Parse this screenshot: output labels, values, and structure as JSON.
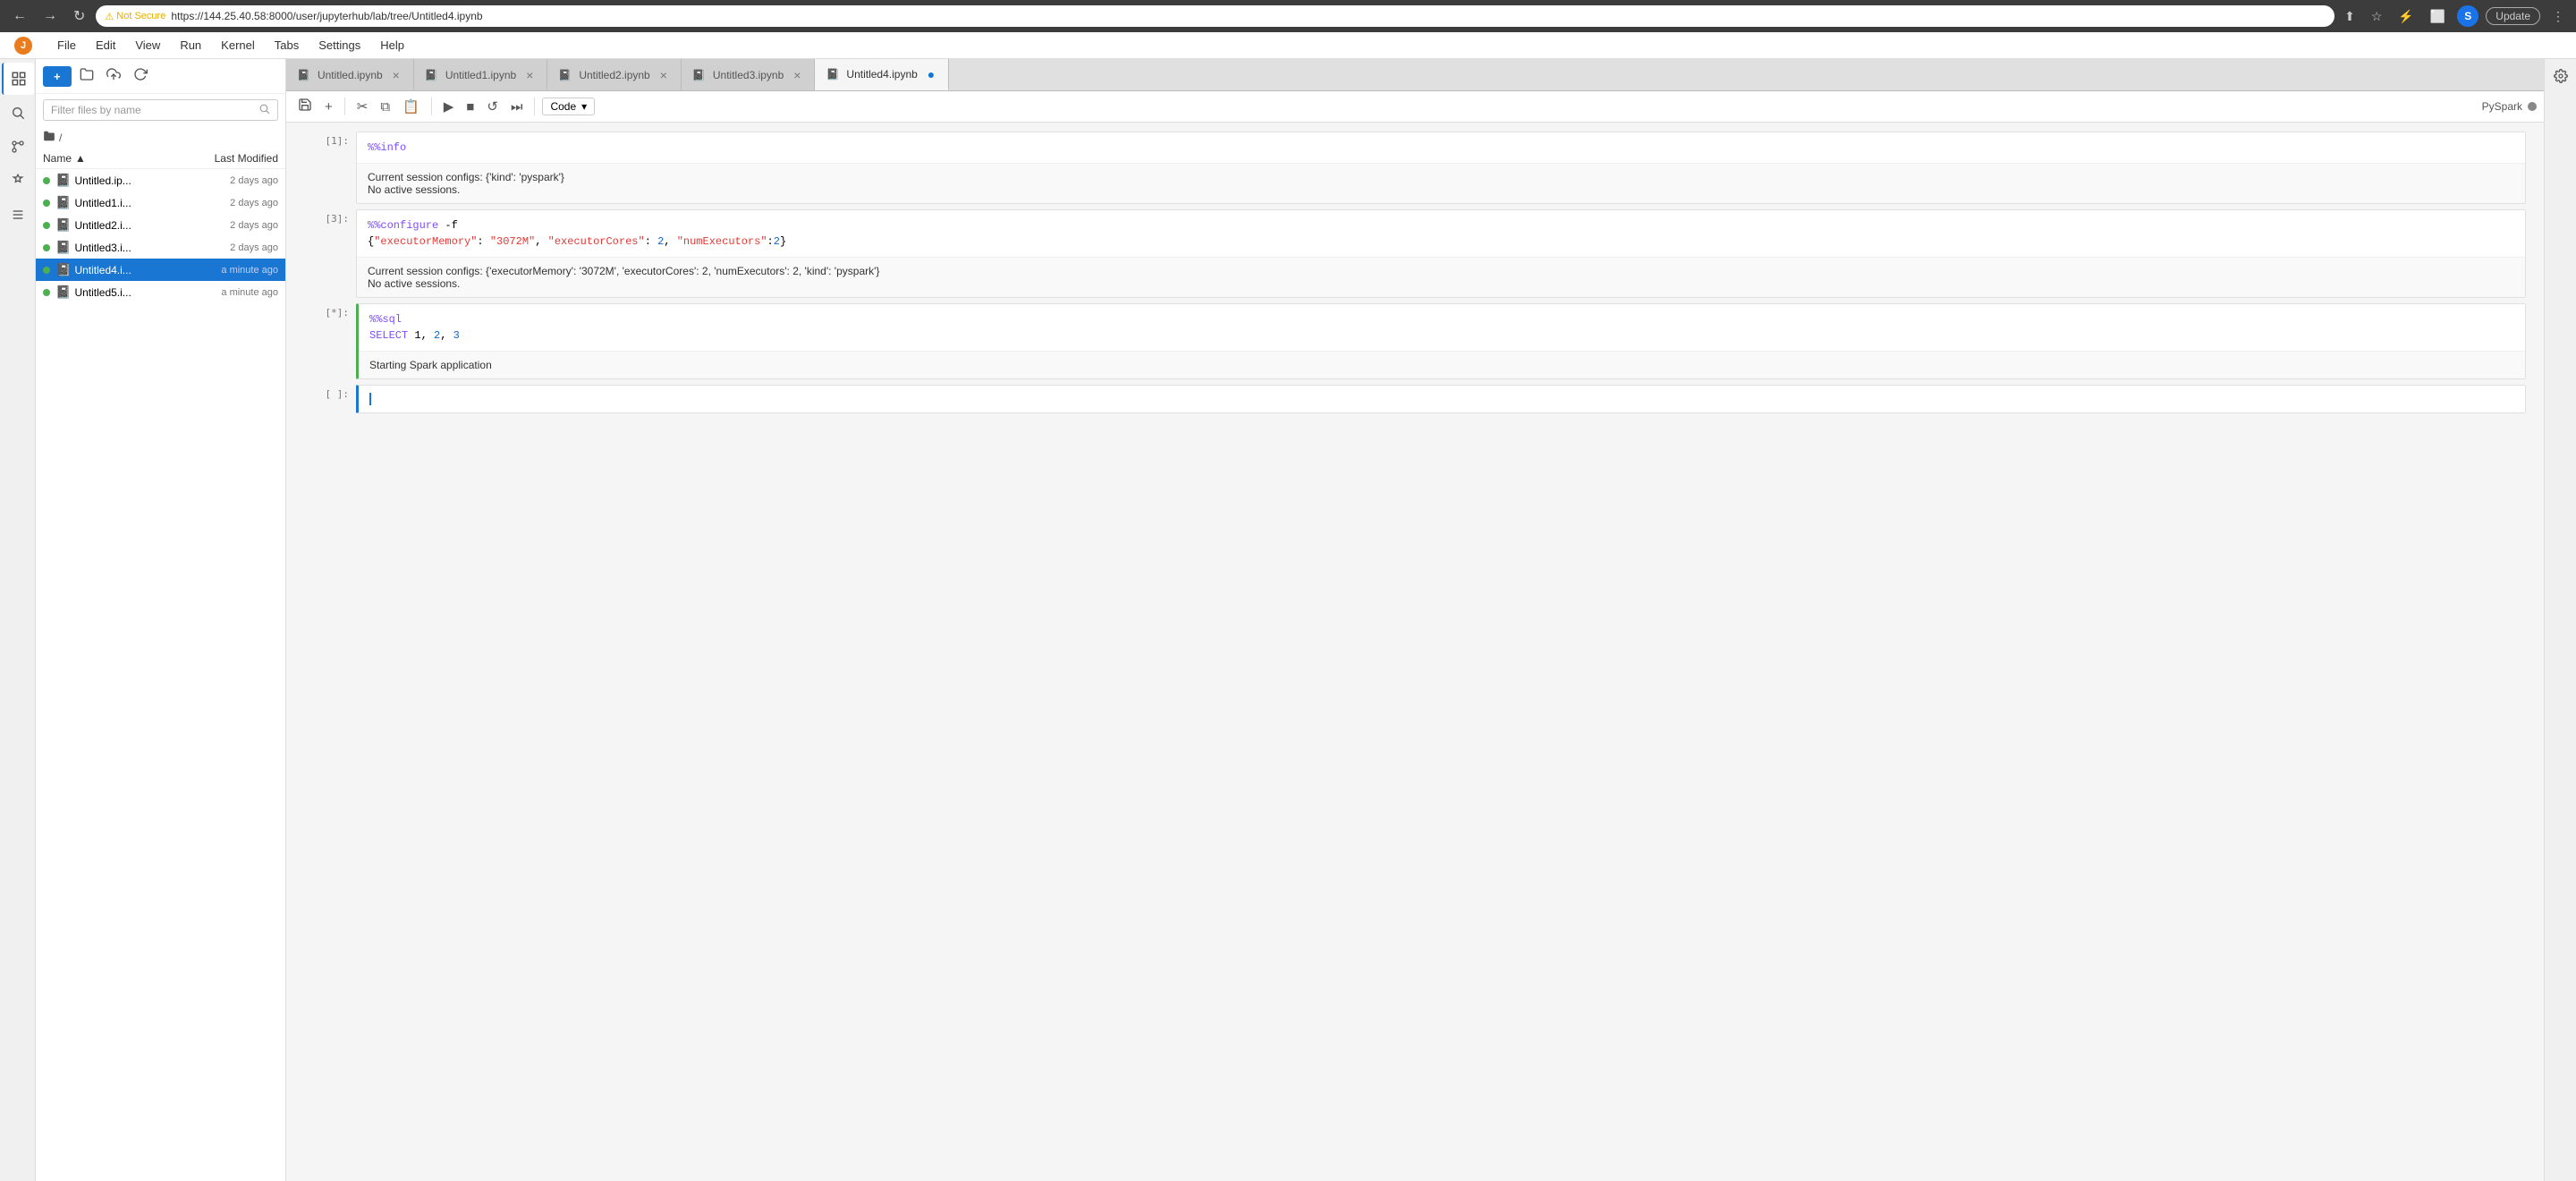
{
  "browser": {
    "back_label": "←",
    "forward_label": "→",
    "refresh_label": "↻",
    "security_warning": "Not Secure",
    "url": "https://144.25.40.58:8000/user/jupyterhub/lab/tree/Untitled4.ipynb",
    "url_short": "https://144.25.40.58:8000/user/jupyterhub/lab/tree/Untitled4.ipynb",
    "update_label": "Update",
    "avatar_letter": "S"
  },
  "menubar": {
    "items": [
      "File",
      "Edit",
      "View",
      "Run",
      "Kernel",
      "Tabs",
      "Settings",
      "Help"
    ]
  },
  "file_browser": {
    "new_button": "+",
    "filter_placeholder": "Filter files by name",
    "breadcrumb": "/",
    "columns": {
      "name": "Name",
      "modified": "Last Modified"
    },
    "files": [
      {
        "name": "Untitled.ip...",
        "modified": "2 days ago",
        "active": false
      },
      {
        "name": "Untitled1.i...",
        "modified": "2 days ago",
        "active": false
      },
      {
        "name": "Untitled2.i...",
        "modified": "2 days ago",
        "active": false
      },
      {
        "name": "Untitled3.i...",
        "modified": "2 days ago",
        "active": false
      },
      {
        "name": "Untitled4.i...",
        "modified": "a minute ago",
        "active": true
      },
      {
        "name": "Untitled5.i...",
        "modified": "a minute ago",
        "active": false
      }
    ]
  },
  "tabs": [
    {
      "label": "Untitled.ipynb",
      "active": false,
      "close": "×"
    },
    {
      "label": "Untitled1.ipynb",
      "active": false,
      "close": "×"
    },
    {
      "label": "Untitled2.ipynb",
      "active": false,
      "close": "×"
    },
    {
      "label": "Untitled3.ipynb",
      "active": false,
      "close": "×"
    },
    {
      "label": "Untitled4.ipynb",
      "active": true,
      "close": "●"
    }
  ],
  "toolbar": {
    "cell_type": "Code",
    "kernel_name": "PySpark",
    "kernel_dot_color": "#888"
  },
  "cells": [
    {
      "number": "[1]:",
      "input_lines": [
        {
          "type": "magic",
          "text": "%%info"
        }
      ],
      "output_lines": [
        {
          "type": "text",
          "text": "Current session configs: {'kind': 'pyspark'}"
        },
        {
          "type": "text",
          "text": "No active sessions."
        }
      ]
    },
    {
      "number": "[3]:",
      "input_lines": [
        {
          "type": "magic",
          "text": "%%configure -f"
        },
        {
          "type": "json",
          "pre": "{",
          "key": "\"executorMemory\"",
          "colon": ": ",
          "val1": "\"3072M\"",
          "comma1": ", ",
          "key2": "\"executorCores\"",
          "colon2": ": ",
          "val2": "2",
          "comma2": ", ",
          "key3": "\"numExecutors\"",
          "colon3": ":",
          "val3": "2",
          "post": "}"
        }
      ],
      "output_lines": [
        {
          "type": "text",
          "text": "Current session configs: {'executorMemory': '3072M', 'executorCores': 2, 'numExecutors': 2, 'kind': 'pyspark'}"
        },
        {
          "type": "text",
          "text": "No active sessions."
        }
      ]
    },
    {
      "number": "[*]:",
      "running": true,
      "input_lines": [
        {
          "type": "magic",
          "text": "%%sql"
        },
        {
          "type": "sql",
          "keyword": "SELECT",
          "rest": " 1, ",
          "n1": "2",
          "comma": ", ",
          "n2": "3"
        }
      ],
      "output_lines": [
        {
          "type": "text",
          "text": "Starting Spark application"
        }
      ]
    },
    {
      "number": "[ ]:",
      "active": true,
      "input_lines": [],
      "output_lines": []
    }
  ]
}
